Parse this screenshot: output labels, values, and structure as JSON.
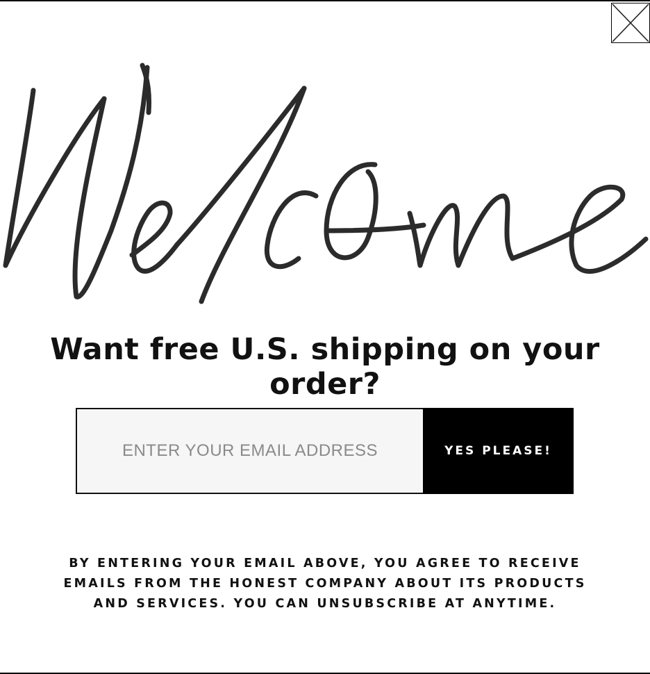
{
  "modal": {
    "close_icon": "close-x-icon",
    "welcome_script_text": "Welcome",
    "headline": "Want free U.S. shipping on your order?",
    "form": {
      "email_placeholder": "ENTER YOUR EMAIL ADDRESS",
      "email_value": "",
      "submit_label": "YES PLEASE!"
    },
    "disclaimer": "BY ENTERING YOUR EMAIL ABOVE, YOU AGREE TO RECEIVE EMAILS FROM THE HONEST COMPANY ABOUT ITS PRODUCTS AND SERVICES. YOU CAN UNSUBSCRIBE AT ANYTIME."
  },
  "colors": {
    "background": "#ffffff",
    "text": "#111111",
    "button_bg": "#000000",
    "button_text": "#ffffff",
    "input_bg": "#f6f6f6",
    "placeholder": "#8a8a8a"
  }
}
